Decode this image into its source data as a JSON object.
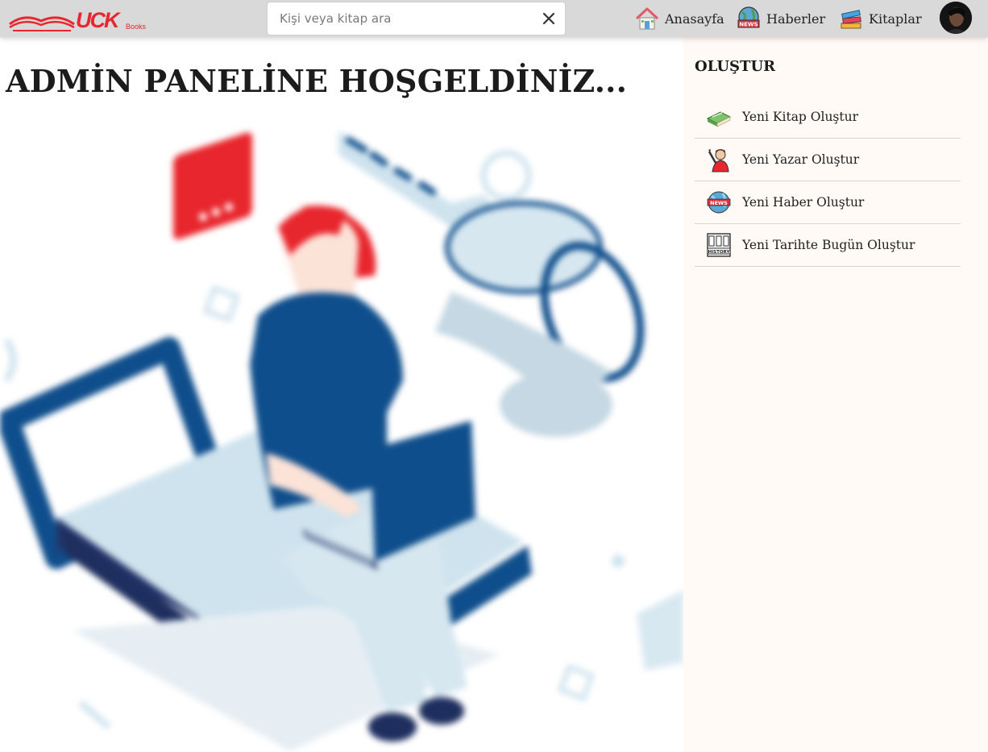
{
  "brand": {
    "logo_text": "UCK",
    "logo_sub": "Books"
  },
  "search": {
    "placeholder": "Kişi veya kitap ara",
    "value": ""
  },
  "nav": [
    {
      "label": "Anasayfa",
      "icon": "house-icon"
    },
    {
      "label": "Haberler",
      "icon": "news-globe-icon"
    },
    {
      "label": "Kitaplar",
      "icon": "books-stack-icon"
    }
  ],
  "main": {
    "title": "ADMİN PANELİNE HOŞGELDİNİZ..."
  },
  "sidebar": {
    "title": "OLUŞTUR",
    "items": [
      {
        "label": "Yeni Kitap Oluştur",
        "icon": "book-icon"
      },
      {
        "label": "Yeni Yazar Oluştur",
        "icon": "writer-icon"
      },
      {
        "label": "Yeni Haber Oluştur",
        "icon": "news-globe-icon"
      },
      {
        "label": "Yeni Tarihte Bugün Oluştur",
        "icon": "history-archive-icon"
      }
    ]
  },
  "colors": {
    "brand_red": "#e8262d",
    "topbar": "#d9d9d9",
    "sidebar_bg": "#fffaf5",
    "hero_blue": "#0f4e8c",
    "hero_light": "#cfe3ee"
  }
}
